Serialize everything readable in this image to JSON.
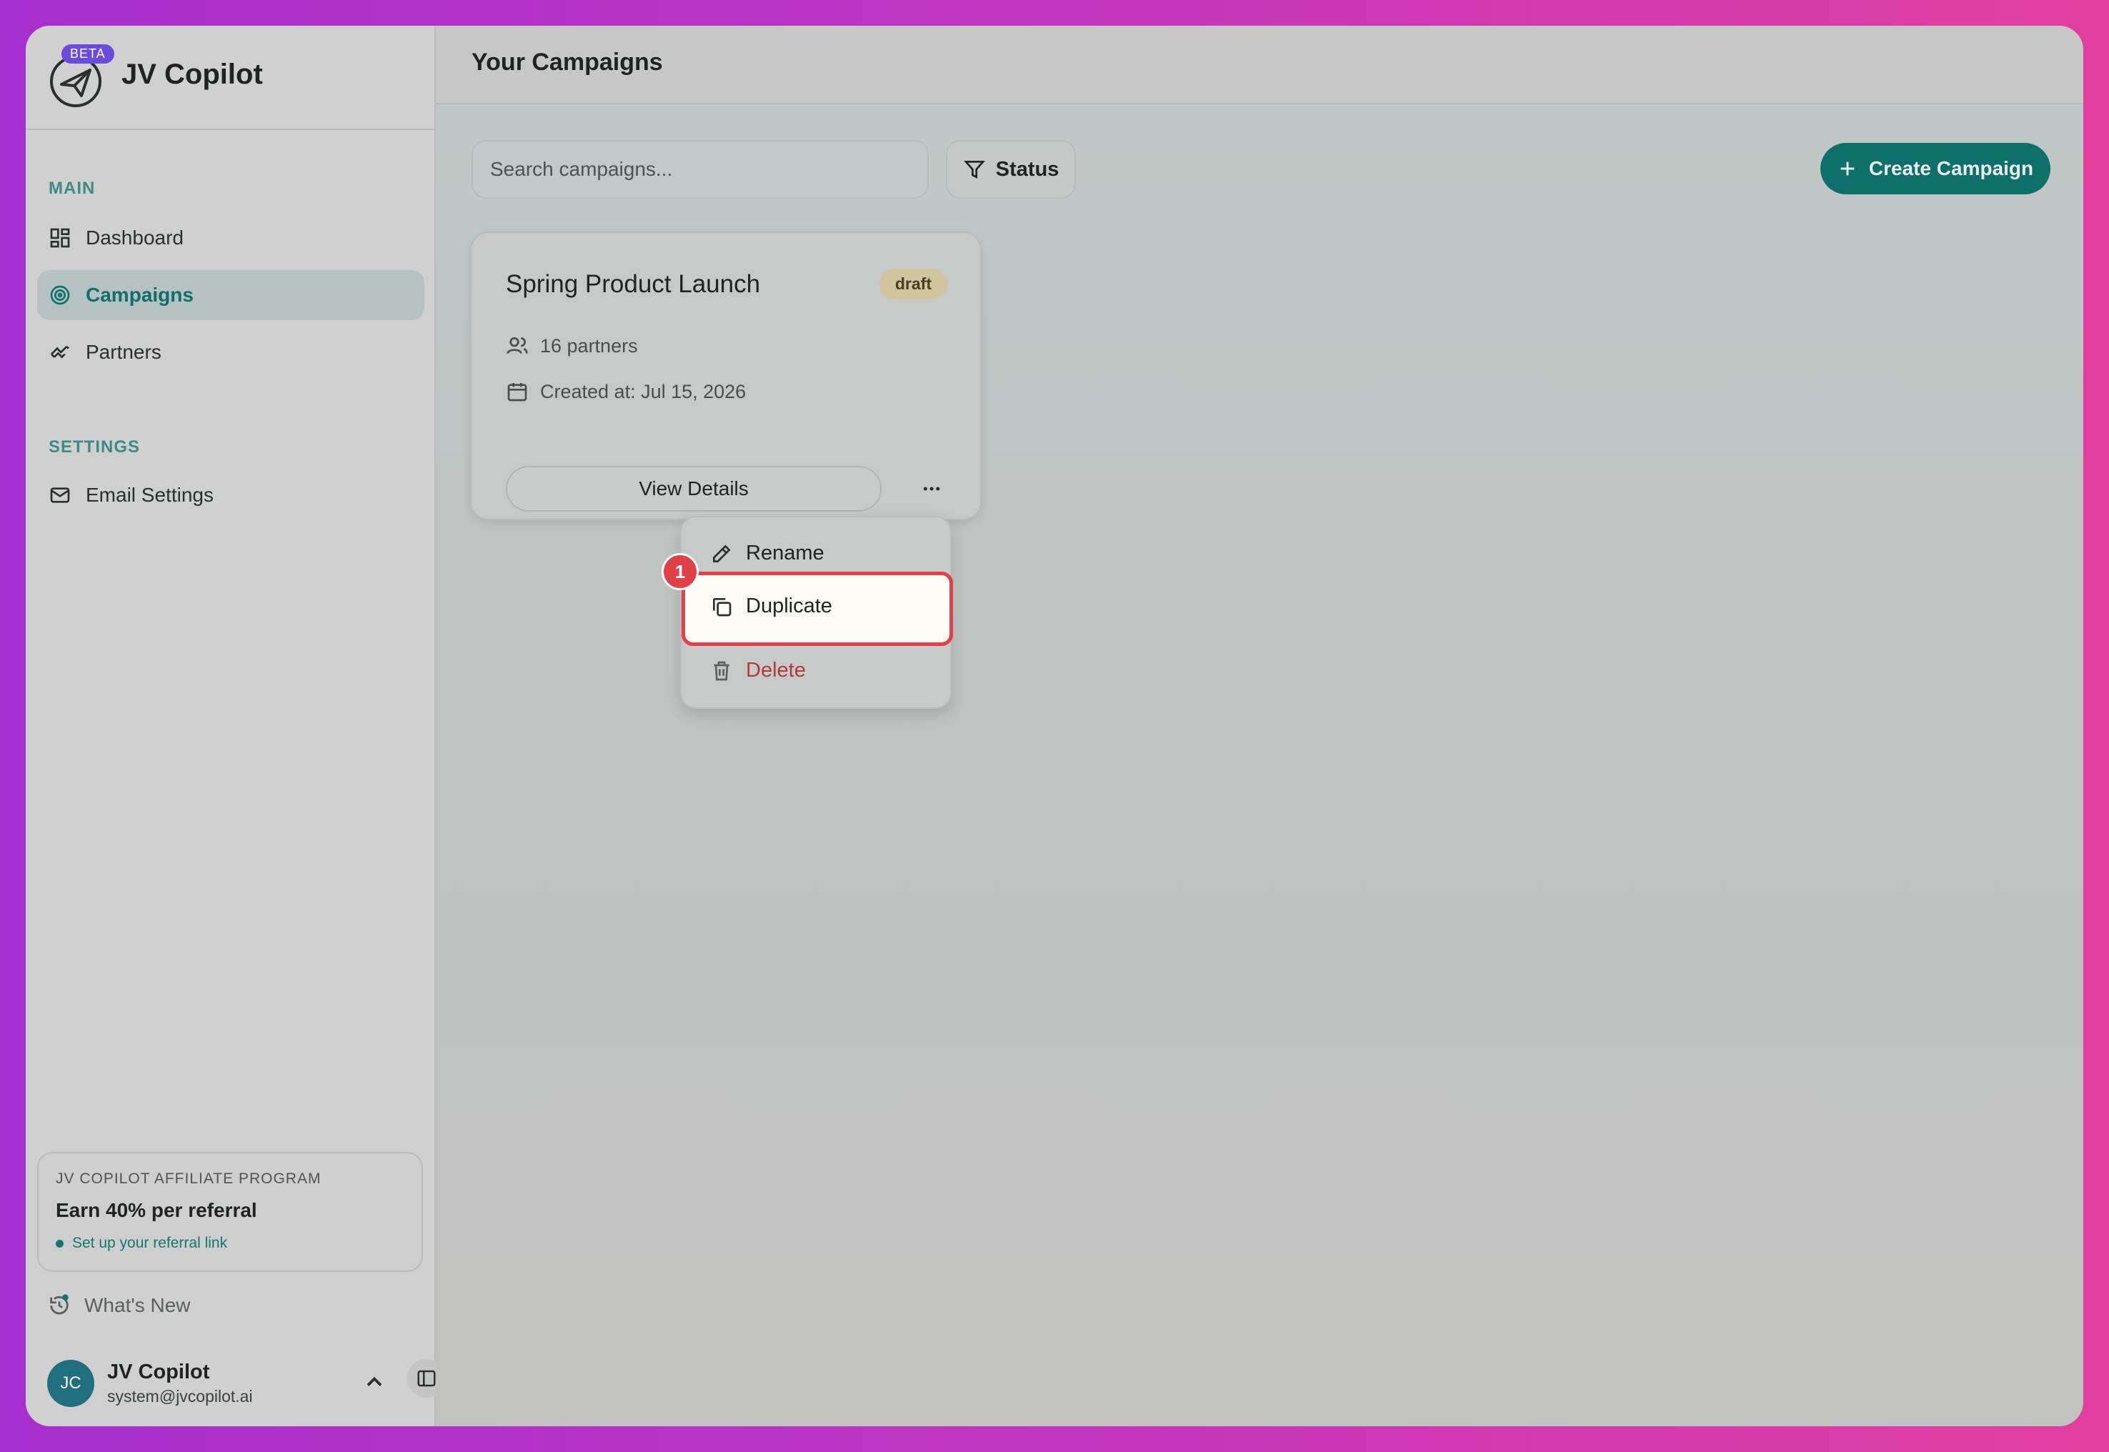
{
  "brand": {
    "name": "JV Copilot",
    "beta": "BETA"
  },
  "sidebar": {
    "main_label": "MAIN",
    "items": [
      {
        "label": "Dashboard",
        "icon": "dashboard-icon"
      },
      {
        "label": "Campaigns",
        "icon": "target-icon"
      },
      {
        "label": "Partners",
        "icon": "handshake-icon"
      }
    ],
    "settings_label": "SETTINGS",
    "settings_items": [
      {
        "label": "Email Settings",
        "icon": "mail-icon"
      }
    ],
    "affiliate": {
      "tag": "JV COPILOT AFFILIATE PROGRAM",
      "title": "Earn 40% per referral",
      "link": "Set up your referral link"
    },
    "whats_new": "What's New",
    "user": {
      "initials": "JC",
      "name": "JV Copilot",
      "email": "system@jvcopilot.ai"
    }
  },
  "header": {
    "title": "Your Campaigns"
  },
  "toolbar": {
    "search_placeholder": "Search campaigns...",
    "status_label": "Status",
    "create_label": "Create Campaign"
  },
  "campaign": {
    "title": "Spring Product Launch",
    "status": "draft",
    "partners": "16 partners",
    "created": "Created at: Jul 15, 2026",
    "view_label": "View Details"
  },
  "menu": {
    "rename": "Rename",
    "duplicate": "Duplicate",
    "delete": "Delete",
    "step": "1"
  },
  "colors": {
    "accent": "#0f6f6a",
    "highlight": "#e0404a",
    "danger": "#b13a3a",
    "badge": "#d2c49e"
  }
}
